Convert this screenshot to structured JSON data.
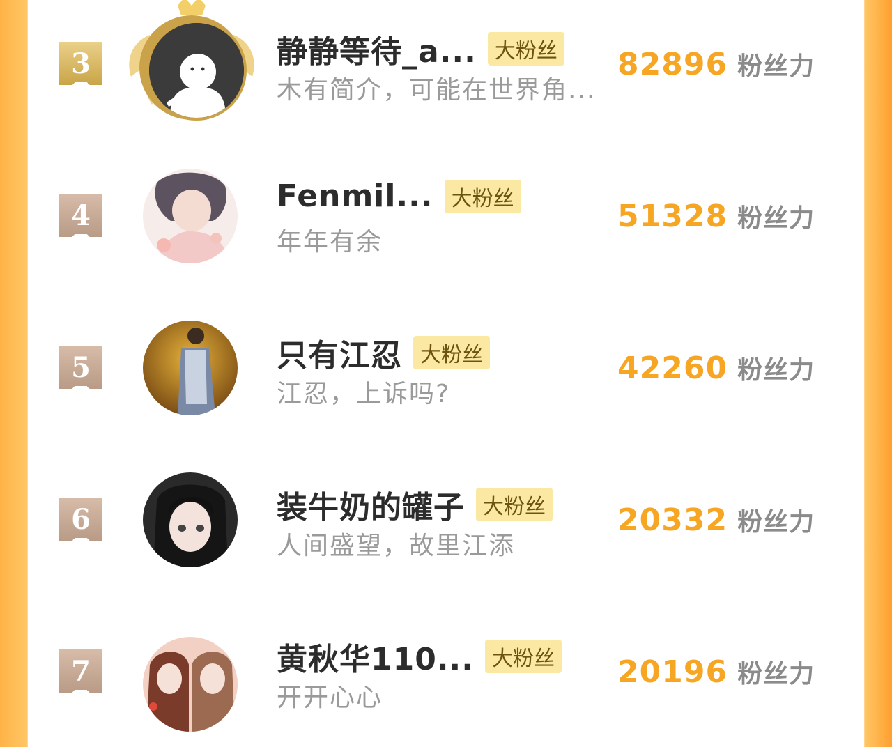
{
  "leaderboard": {
    "rows": [
      {
        "rank": "3",
        "name": "静静等待_a...",
        "tag": "大粉丝",
        "bio": "木有简介，可能在世界角...",
        "score": "82896",
        "unit": "粉丝力"
      },
      {
        "rank": "4",
        "name": "Fenmil...",
        "tag": "大粉丝",
        "bio": "年年有余",
        "score": "51328",
        "unit": "粉丝力"
      },
      {
        "rank": "5",
        "name": "只有江忍",
        "tag": "大粉丝",
        "bio": "江忍，上诉吗?",
        "score": "42260",
        "unit": "粉丝力"
      },
      {
        "rank": "6",
        "name": "装牛奶的罐子",
        "tag": "大粉丝",
        "bio": "人间盛望，故里江添",
        "score": "20332",
        "unit": "粉丝力"
      },
      {
        "rank": "7",
        "name": "黄秋华110...",
        "tag": "大粉丝",
        "bio": "开开心心",
        "score": "20196",
        "unit": "粉丝力"
      }
    ]
  },
  "colors": {
    "accent": "#f6a623",
    "tag_bg": "#fbe9a3",
    "gold_badge": "#d7b55f",
    "tan_badge": "#c4a690"
  },
  "icons": {
    "top_rank_decoration": "gold-crown-wings-icon",
    "default_avatar": "default-person-avatar-icon"
  }
}
